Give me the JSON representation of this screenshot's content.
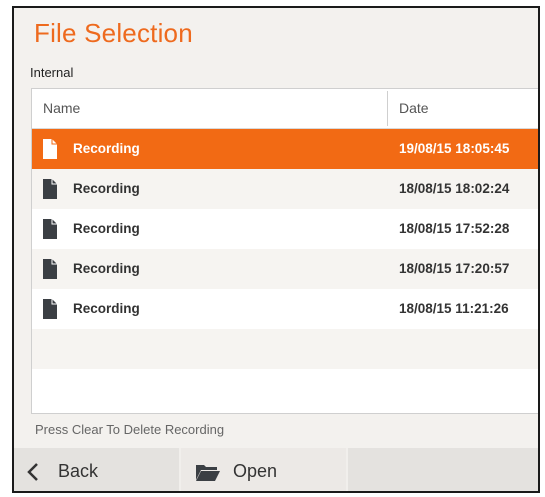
{
  "title": "File Selection",
  "section": "Internal",
  "columns": {
    "name": "Name",
    "date": "Date"
  },
  "files": [
    {
      "name": "Recording",
      "date": "19/08/15 18:05:45",
      "selected": true
    },
    {
      "name": "Recording",
      "date": "18/08/15 18:02:24",
      "selected": false
    },
    {
      "name": "Recording",
      "date": "18/08/15 17:52:28",
      "selected": false
    },
    {
      "name": "Recording",
      "date": "18/08/15 17:20:57",
      "selected": false
    },
    {
      "name": "Recording",
      "date": "18/08/15 11:21:26",
      "selected": false
    }
  ],
  "hint": "Press Clear To Delete Recording",
  "footer": {
    "back_label": "Back",
    "open_label": "Open"
  },
  "colors": {
    "accent": "#f26a14",
    "title": "#ee6a1e"
  },
  "icons": {
    "file": "document-icon",
    "back": "chevron-left-icon",
    "open": "folder-icon"
  }
}
